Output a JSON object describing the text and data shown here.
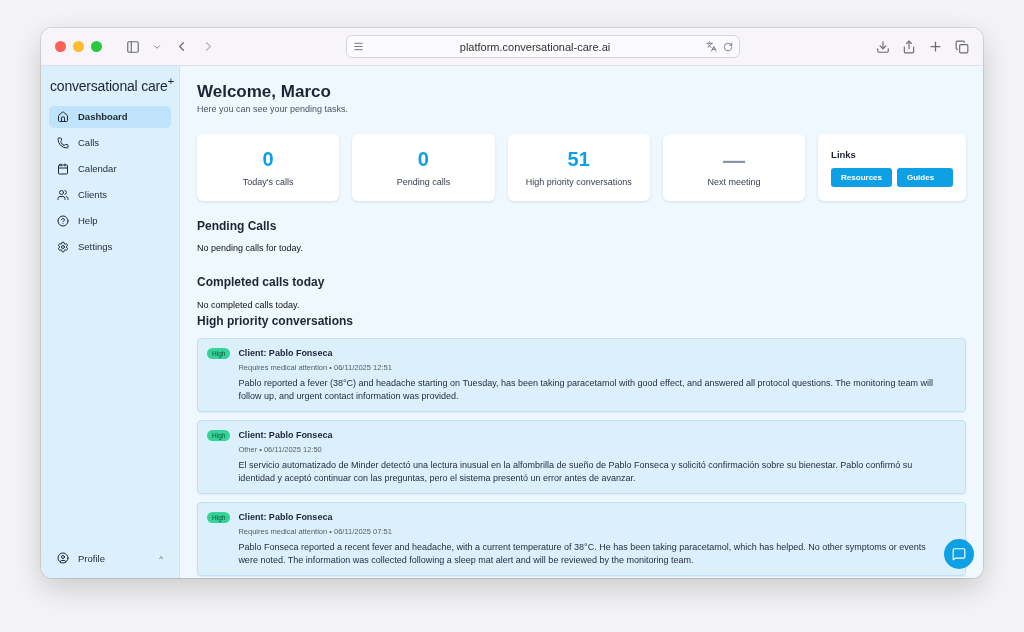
{
  "browser": {
    "url": "platform.conversational-care.ai"
  },
  "sidebar": {
    "logo": "conversational care",
    "logo_mark": "+",
    "items": [
      {
        "label": "Dashboard",
        "selected": true
      },
      {
        "label": "Calls",
        "selected": false
      },
      {
        "label": "Calendar",
        "selected": false
      },
      {
        "label": "Clients",
        "selected": false
      },
      {
        "label": "Help",
        "selected": false
      },
      {
        "label": "Settings",
        "selected": false
      }
    ],
    "profile": {
      "label": "Profile",
      "caret": "^"
    }
  },
  "header": {
    "title": "Welcome, Marco",
    "subtitle": "Here you can see your pending tasks."
  },
  "stats": [
    {
      "value": "0",
      "label": "Today's calls",
      "kind": "number"
    },
    {
      "value": "0",
      "label": "Pending calls",
      "kind": "number"
    },
    {
      "value": "51",
      "label": "High priority conversations",
      "kind": "number"
    },
    {
      "value": "—",
      "label": "Next meeting",
      "kind": "dash"
    }
  ],
  "links": {
    "title": "Links",
    "buttons": [
      "Resources",
      "Guides"
    ]
  },
  "sections": [
    {
      "title": "Pending Calls",
      "empty": "No pending calls for today."
    },
    {
      "title": "Completed calls today",
      "empty": "No completed calls today."
    }
  ],
  "high_priority": {
    "title": "High priority conversations",
    "items": [
      {
        "badge": "High",
        "client": "Client: Pablo Fonseca",
        "meta": "Requires medical attention • 06/11/2025 12:51",
        "summary": "Pablo reported a fever (38°C) and headache starting on Tuesday, has been taking paracetamol with good effect, and answered all protocol questions. The monitoring team will follow up, and urgent contact information was provided."
      },
      {
        "badge": "High",
        "client": "Client: Pablo Fonseca",
        "meta": "Other • 06/11/2025 12:50",
        "summary": "El servicio automatizado de Minder detectó una lectura inusual en la alfombrilla de sueño de Pablo Fonseca y solicitó confirmación sobre su bienestar. Pablo confirmó su identidad y aceptó continuar con las preguntas, pero el sistema presentó un error antes de avanzar."
      },
      {
        "badge": "High",
        "client": "Client: Pablo Fonseca",
        "meta": "Requires medical attention • 06/11/2025 07:51",
        "summary": "Pablo Fonseca reported a recent fever and headache, with a current temperature of 38°C. He has been taking paracetamol, which has helped. No other symptoms or events were noted. The information was collected following a sleep mat alert and will be reviewed by the monitoring team."
      }
    ]
  }
}
